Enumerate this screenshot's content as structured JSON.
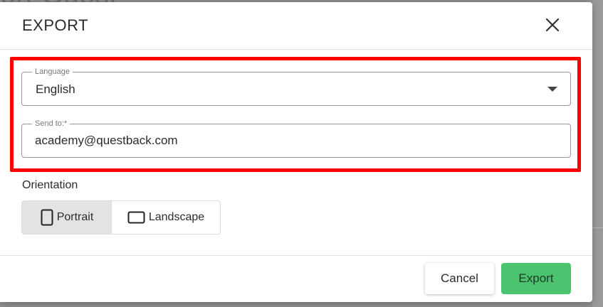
{
  "background": {
    "heading_fragment": "ort Guest"
  },
  "modal": {
    "title": "EXPORT",
    "close_icon": "close-icon",
    "language_field": {
      "label": "Language",
      "value": "English",
      "dropdown_icon": "chevron-down-icon"
    },
    "send_to_field": {
      "label": "Send to:*",
      "value": "academy@questback.com"
    },
    "orientation": {
      "label": "Orientation",
      "options": [
        {
          "label": "Portrait",
          "icon": "portrait-icon",
          "selected": true
        },
        {
          "label": "Landscape",
          "icon": "landscape-icon",
          "selected": false
        }
      ]
    },
    "footer": {
      "cancel_label": "Cancel",
      "export_label": "Export"
    }
  },
  "colors": {
    "highlight": "#ff0000",
    "export_button": "#4cc36e",
    "selected_toggle": "#e3e3e3"
  }
}
